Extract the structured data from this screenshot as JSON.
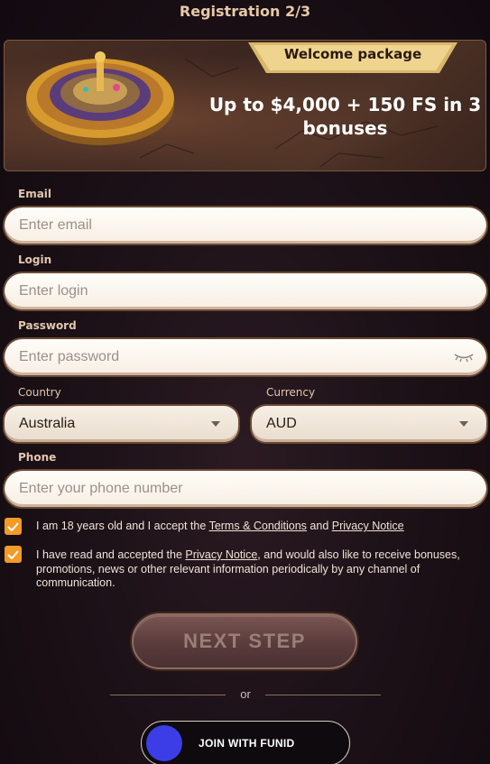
{
  "header": {
    "title": "Registration 2/3"
  },
  "banner": {
    "badge": "Welcome package",
    "line1": "Up to $4,000 + 150 FS in 3",
    "line2": "bonuses"
  },
  "form": {
    "email": {
      "label": "Email",
      "placeholder": "Enter email"
    },
    "login": {
      "label": "Login",
      "placeholder": "Enter login"
    },
    "password": {
      "label": "Password",
      "placeholder": "Enter password"
    },
    "country": {
      "label": "Country",
      "value": "Australia"
    },
    "currency": {
      "label": "Currency",
      "value": "AUD"
    },
    "phone": {
      "label": "Phone",
      "placeholder": "Enter your phone number"
    }
  },
  "consents": {
    "age": {
      "prefix": "I am 18 years old and I accept the ",
      "terms": "Terms & Conditions",
      "and": " and ",
      "privacy": "Privacy Notice"
    },
    "marketing": {
      "prefix": "I have read and accepted the ",
      "privacy": "Privacy Notice",
      "suffix": ", and would also like to receive bonuses, promotions, news or other relevant information periodically by any channel of communication."
    }
  },
  "actions": {
    "next": "NEXT STEP",
    "or": "or",
    "funid": "JOIN WITH FUNID"
  },
  "colors": {
    "accent_checkbox": "#f39a27",
    "funid_dot": "#3d3de8",
    "background": "#1a1016"
  },
  "icons": {
    "password_toggle": "eye-closed-icon",
    "dropdown": "caret-down-icon",
    "checkbox": "checkmark-icon"
  }
}
